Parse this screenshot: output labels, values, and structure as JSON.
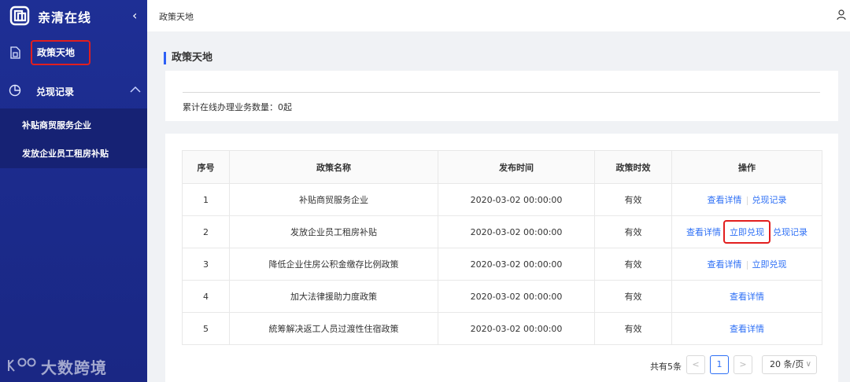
{
  "app": {
    "title": "亲清在线"
  },
  "sidebar": {
    "policy_label": "政策天地",
    "redeem_label": "兑现记录",
    "sub_items": [
      "补贴商贸服务企业",
      "发放企业员工租房补贴"
    ]
  },
  "header": {
    "breadcrumb": "政策天地"
  },
  "page": {
    "title": "政策天地",
    "summary": "累计在线办理业务数量：0起"
  },
  "table": {
    "columns": [
      "序号",
      "政策名称",
      "发布时间",
      "政策时效",
      "操作"
    ],
    "rows": [
      {
        "no": "1",
        "name": "补贴商贸服务企业",
        "time": "2020-03-02 00:00:00",
        "status": "有效",
        "actions": [
          "查看详情",
          "兑现记录"
        ]
      },
      {
        "no": "2",
        "name": "发放企业员工租房补贴",
        "time": "2020-03-02 00:00:00",
        "status": "有效",
        "actions": [
          "查看详情",
          "立即兑现",
          "兑现记录"
        ]
      },
      {
        "no": "3",
        "name": "降低企业住房公积金缴存比例政策",
        "time": "2020-03-02 00:00:00",
        "status": "有效",
        "actions": [
          "查看详情",
          "立即兑现"
        ]
      },
      {
        "no": "4",
        "name": "加大法律援助力度政策",
        "time": "2020-03-02 00:00:00",
        "status": "有效",
        "actions": [
          "查看详情"
        ]
      },
      {
        "no": "5",
        "name": "統筹解决返工人员过渡性住宿政策",
        "time": "2020-03-02 00:00:00",
        "status": "有效",
        "actions": [
          "查看详情"
        ]
      }
    ]
  },
  "pagination": {
    "total": "共有5条",
    "prev": "<",
    "current": "1",
    "next": ">",
    "page_size": "20 条/页"
  },
  "watermark": {
    "text": "大数跨境"
  },
  "colors": {
    "sidebar": "#1e2f95",
    "accent": "#2d6ff5",
    "highlight": "#e21e1e"
  }
}
